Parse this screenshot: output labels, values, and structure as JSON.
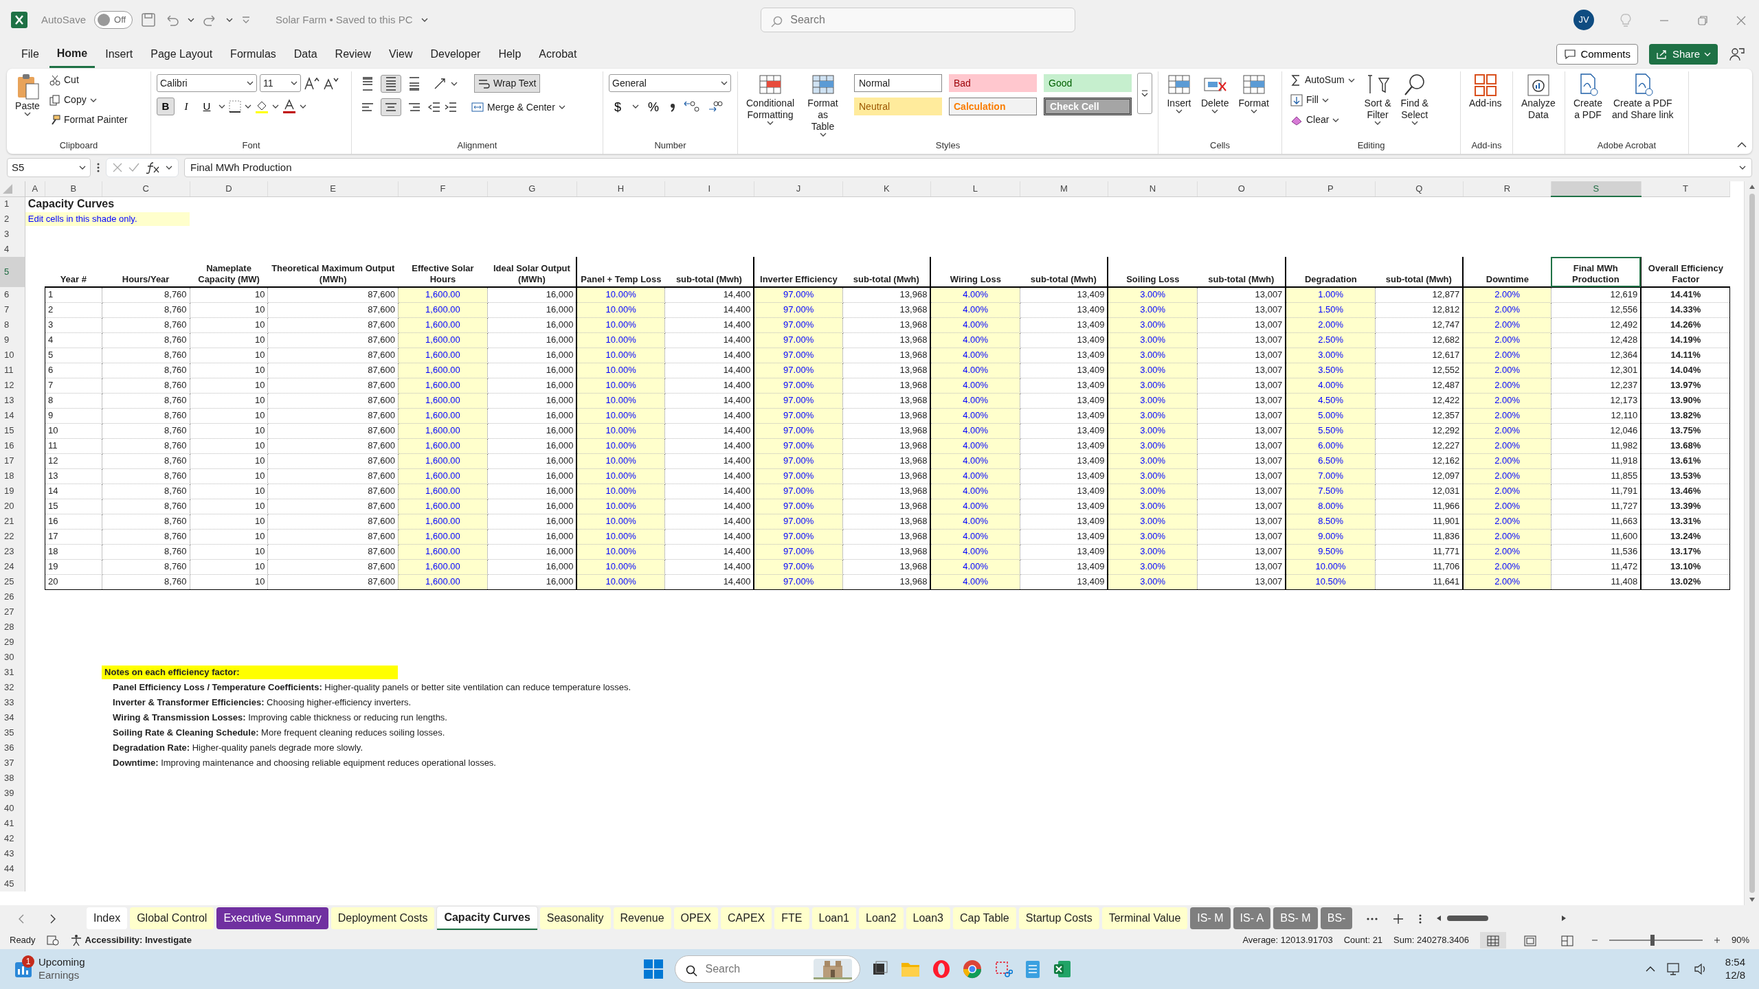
{
  "title_bar": {
    "autosave_label": "AutoSave",
    "autosave": {
      "label": "Off",
      "on": false
    },
    "document_title": "Solar Farm • Saved to this PC",
    "search_placeholder": "Search",
    "avatar": "JV"
  },
  "menu_tabs": [
    {
      "label": "File",
      "selected": false
    },
    {
      "label": "Home",
      "selected": true
    },
    {
      "label": "Insert",
      "selected": false
    },
    {
      "label": "Page Layout",
      "selected": false
    },
    {
      "label": "Formulas",
      "selected": false
    },
    {
      "label": "Data",
      "selected": false
    },
    {
      "label": "Review",
      "selected": false
    },
    {
      "label": "View",
      "selected": false
    },
    {
      "label": "Developer",
      "selected": false
    },
    {
      "label": "Help",
      "selected": false
    },
    {
      "label": "Acrobat",
      "selected": false
    }
  ],
  "header_buttons": [
    "Comments",
    "Share"
  ],
  "ribbon": {
    "groups": [
      {
        "label": "Clipboard",
        "paste": "Paste",
        "buttons": [
          "Cut",
          "Copy",
          "Format Painter"
        ]
      },
      {
        "label": "Font",
        "font": "Calibri",
        "size": "11",
        "format_buttons": [
          {
            "label": "B",
            "selected": true
          },
          {
            "label": "I",
            "selected": false
          },
          {
            "label": "U",
            "selected": false
          }
        ]
      },
      {
        "label": "Alignment",
        "vertical_align": [
          {
            "selected": false
          },
          {
            "selected": true
          },
          {
            "selected": false
          }
        ],
        "horizontal_align": [
          {
            "selected": false
          },
          {
            "selected": true
          },
          {
            "selected": false
          }
        ],
        "wrap_text": {
          "label": "Wrap Text",
          "selected": true
        },
        "merge": "Merge & Center"
      },
      {
        "label": "Number",
        "format": "General",
        "buttons": [
          "$",
          "%"
        ]
      },
      {
        "label": "Styles",
        "buttons": [
          "Conditional\nFormatting",
          "Format as\nTable"
        ],
        "cell_styles": [
          {
            "label": "Normal",
            "kind": "normal"
          },
          {
            "label": "Bad",
            "kind": "bad"
          },
          {
            "label": "Good",
            "kind": "good"
          },
          {
            "label": "Neutral",
            "kind": "neutral"
          },
          {
            "label": "Calculation",
            "kind": "calculation"
          },
          {
            "label": "Check Cell",
            "kind": "check"
          }
        ]
      },
      {
        "label": "Cells",
        "buttons": [
          "Insert",
          "Delete",
          "Format"
        ]
      },
      {
        "label": "Editing",
        "small_buttons": [
          "AutoSum",
          "Fill",
          "Clear"
        ],
        "buttons": [
          "Sort &\nFilter",
          "Find &\nSelect"
        ]
      },
      {
        "label": "Add-ins",
        "buttons": [
          "Add-ins"
        ]
      },
      {
        "buttons": [
          "Analyze\nData"
        ]
      },
      {
        "label": "Adobe Acrobat",
        "buttons": [
          "Create\na PDF",
          "Create a PDF\nand Share link"
        ]
      }
    ]
  },
  "formula_bar": {
    "name_box": "S5",
    "formula": "Final MWh Production"
  },
  "column_letters": [
    {
      "label": "A",
      "selected": false
    },
    {
      "label": "B",
      "selected": false
    },
    {
      "label": "C",
      "selected": false
    },
    {
      "label": "D",
      "selected": false
    },
    {
      "label": "E",
      "selected": false
    },
    {
      "label": "F",
      "selected": false
    },
    {
      "label": "G",
      "selected": false
    },
    {
      "label": "H",
      "selected": false
    },
    {
      "label": "I",
      "selected": false
    },
    {
      "label": "J",
      "selected": false
    },
    {
      "label": "K",
      "selected": false
    },
    {
      "label": "L",
      "selected": false
    },
    {
      "label": "M",
      "selected": false
    },
    {
      "label": "N",
      "selected": false
    },
    {
      "label": "O",
      "selected": false
    },
    {
      "label": "P",
      "selected": false
    },
    {
      "label": "Q",
      "selected": false
    },
    {
      "label": "R",
      "selected": false
    },
    {
      "label": "S",
      "selected": true
    },
    {
      "label": "T",
      "selected": false
    }
  ],
  "row_numbers": [
    {
      "label": "1",
      "selected": false
    },
    {
      "label": "2",
      "selected": false
    },
    {
      "label": "3",
      "selected": false
    },
    {
      "label": "4",
      "selected": false
    },
    {
      "label": "5",
      "selected": true
    },
    {
      "label": "6",
      "selected": false
    },
    {
      "label": "7",
      "selected": false
    },
    {
      "label": "8",
      "selected": false
    },
    {
      "label": "9",
      "selected": false
    },
    {
      "label": "10",
      "selected": false
    },
    {
      "label": "11",
      "selected": false
    },
    {
      "label": "12",
      "selected": false
    },
    {
      "label": "13",
      "selected": false
    },
    {
      "label": "14",
      "selected": false
    },
    {
      "label": "15",
      "selected": false
    },
    {
      "label": "16",
      "selected": false
    },
    {
      "label": "17",
      "selected": false
    },
    {
      "label": "18",
      "selected": false
    },
    {
      "label": "19",
      "selected": false
    },
    {
      "label": "20",
      "selected": false
    },
    {
      "label": "21",
      "selected": false
    },
    {
      "label": "22",
      "selected": false
    },
    {
      "label": "23",
      "selected": false
    },
    {
      "label": "24",
      "selected": false
    },
    {
      "label": "25",
      "selected": false
    },
    {
      "label": "26",
      "selected": false
    },
    {
      "label": "27",
      "selected": false
    },
    {
      "label": "28",
      "selected": false
    },
    {
      "label": "29",
      "selected": false
    },
    {
      "label": "30",
      "selected": false
    },
    {
      "label": "31",
      "selected": false
    },
    {
      "label": "32",
      "selected": false
    },
    {
      "label": "33",
      "selected": false
    },
    {
      "label": "34",
      "selected": false
    },
    {
      "label": "35",
      "selected": false
    },
    {
      "label": "36",
      "selected": false
    },
    {
      "label": "37",
      "selected": false
    },
    {
      "label": "38",
      "selected": false
    },
    {
      "label": "39",
      "selected": false
    },
    {
      "label": "40",
      "selected": false
    },
    {
      "label": "41",
      "selected": false
    },
    {
      "label": "42",
      "selected": false
    },
    {
      "label": "43",
      "selected": false
    },
    {
      "label": "44",
      "selected": false
    },
    {
      "label": "45",
      "selected": false
    }
  ],
  "sheet": {
    "title": "Capacity Curves",
    "hint": "Edit cells in this shade only.",
    "table": {
      "columns": [
        {
          "header": "Year #",
          "kind": "year"
        },
        {
          "header": "Hours/Year",
          "kind": "calc"
        },
        {
          "header": "Nameplate Capacity (MW)",
          "kind": "calc"
        },
        {
          "header": "Theoretical Maximum Output (MWh)",
          "kind": "calc"
        },
        {
          "header": "Effective Solar Hours",
          "kind": "input"
        },
        {
          "header": "Ideal Solar Output (MWh)",
          "kind": "calc"
        },
        {
          "header": "Panel + Temp Loss",
          "kind": "input"
        },
        {
          "header": "sub-total (Mwh)",
          "kind": "calc"
        },
        {
          "header": "Inverter Efficiency",
          "kind": "input"
        },
        {
          "header": "sub-total (Mwh)",
          "kind": "calc"
        },
        {
          "header": "Wiring Loss",
          "kind": "input"
        },
        {
          "header": "sub-total (Mwh)",
          "kind": "calc"
        },
        {
          "header": "Soiling Loss",
          "kind": "input"
        },
        {
          "header": "sub-total (Mwh)",
          "kind": "calc"
        },
        {
          "header": "Degradation",
          "kind": "input"
        },
        {
          "header": "sub-total (Mwh)",
          "kind": "calc"
        },
        {
          "header": "Downtime",
          "kind": "input"
        },
        {
          "header": "Final MWh Production",
          "kind": "calc"
        },
        {
          "header": "Overall Efficiency Factor",
          "kind": "result"
        }
      ],
      "rows": [
        [
          "1",
          "8,760",
          "10",
          "87,600",
          "1,600.00",
          "16,000",
          "10.00%",
          "14,400",
          "97.00%",
          "13,968",
          "4.00%",
          "13,409",
          "3.00%",
          "13,007",
          "1.00%",
          "12,877",
          "2.00%",
          "12,619",
          "14.41%"
        ],
        [
          "2",
          "8,760",
          "10",
          "87,600",
          "1,600.00",
          "16,000",
          "10.00%",
          "14,400",
          "97.00%",
          "13,968",
          "4.00%",
          "13,409",
          "3.00%",
          "13,007",
          "1.50%",
          "12,812",
          "2.00%",
          "12,556",
          "14.33%"
        ],
        [
          "3",
          "8,760",
          "10",
          "87,600",
          "1,600.00",
          "16,000",
          "10.00%",
          "14,400",
          "97.00%",
          "13,968",
          "4.00%",
          "13,409",
          "3.00%",
          "13,007",
          "2.00%",
          "12,747",
          "2.00%",
          "12,492",
          "14.26%"
        ],
        [
          "4",
          "8,760",
          "10",
          "87,600",
          "1,600.00",
          "16,000",
          "10.00%",
          "14,400",
          "97.00%",
          "13,968",
          "4.00%",
          "13,409",
          "3.00%",
          "13,007",
          "2.50%",
          "12,682",
          "2.00%",
          "12,428",
          "14.19%"
        ],
        [
          "5",
          "8,760",
          "10",
          "87,600",
          "1,600.00",
          "16,000",
          "10.00%",
          "14,400",
          "97.00%",
          "13,968",
          "4.00%",
          "13,409",
          "3.00%",
          "13,007",
          "3.00%",
          "12,617",
          "2.00%",
          "12,364",
          "14.11%"
        ],
        [
          "6",
          "8,760",
          "10",
          "87,600",
          "1,600.00",
          "16,000",
          "10.00%",
          "14,400",
          "97.00%",
          "13,968",
          "4.00%",
          "13,409",
          "3.00%",
          "13,007",
          "3.50%",
          "12,552",
          "2.00%",
          "12,301",
          "14.04%"
        ],
        [
          "7",
          "8,760",
          "10",
          "87,600",
          "1,600.00",
          "16,000",
          "10.00%",
          "14,400",
          "97.00%",
          "13,968",
          "4.00%",
          "13,409",
          "3.00%",
          "13,007",
          "4.00%",
          "12,487",
          "2.00%",
          "12,237",
          "13.97%"
        ],
        [
          "8",
          "8,760",
          "10",
          "87,600",
          "1,600.00",
          "16,000",
          "10.00%",
          "14,400",
          "97.00%",
          "13,968",
          "4.00%",
          "13,409",
          "3.00%",
          "13,007",
          "4.50%",
          "12,422",
          "2.00%",
          "12,173",
          "13.90%"
        ],
        [
          "9",
          "8,760",
          "10",
          "87,600",
          "1,600.00",
          "16,000",
          "10.00%",
          "14,400",
          "97.00%",
          "13,968",
          "4.00%",
          "13,409",
          "3.00%",
          "13,007",
          "5.00%",
          "12,357",
          "2.00%",
          "12,110",
          "13.82%"
        ],
        [
          "10",
          "8,760",
          "10",
          "87,600",
          "1,600.00",
          "16,000",
          "10.00%",
          "14,400",
          "97.00%",
          "13,968",
          "4.00%",
          "13,409",
          "3.00%",
          "13,007",
          "5.50%",
          "12,292",
          "2.00%",
          "12,046",
          "13.75%"
        ],
        [
          "11",
          "8,760",
          "10",
          "87,600",
          "1,600.00",
          "16,000",
          "10.00%",
          "14,400",
          "97.00%",
          "13,968",
          "4.00%",
          "13,409",
          "3.00%",
          "13,007",
          "6.00%",
          "12,227",
          "2.00%",
          "11,982",
          "13.68%"
        ],
        [
          "12",
          "8,760",
          "10",
          "87,600",
          "1,600.00",
          "16,000",
          "10.00%",
          "14,400",
          "97.00%",
          "13,968",
          "4.00%",
          "13,409",
          "3.00%",
          "13,007",
          "6.50%",
          "12,162",
          "2.00%",
          "11,918",
          "13.61%"
        ],
        [
          "13",
          "8,760",
          "10",
          "87,600",
          "1,600.00",
          "16,000",
          "10.00%",
          "14,400",
          "97.00%",
          "13,968",
          "4.00%",
          "13,409",
          "3.00%",
          "13,007",
          "7.00%",
          "12,097",
          "2.00%",
          "11,855",
          "13.53%"
        ],
        [
          "14",
          "8,760",
          "10",
          "87,600",
          "1,600.00",
          "16,000",
          "10.00%",
          "14,400",
          "97.00%",
          "13,968",
          "4.00%",
          "13,409",
          "3.00%",
          "13,007",
          "7.50%",
          "12,031",
          "2.00%",
          "11,791",
          "13.46%"
        ],
        [
          "15",
          "8,760",
          "10",
          "87,600",
          "1,600.00",
          "16,000",
          "10.00%",
          "14,400",
          "97.00%",
          "13,968",
          "4.00%",
          "13,409",
          "3.00%",
          "13,007",
          "8.00%",
          "11,966",
          "2.00%",
          "11,727",
          "13.39%"
        ],
        [
          "16",
          "8,760",
          "10",
          "87,600",
          "1,600.00",
          "16,000",
          "10.00%",
          "14,400",
          "97.00%",
          "13,968",
          "4.00%",
          "13,409",
          "3.00%",
          "13,007",
          "8.50%",
          "11,901",
          "2.00%",
          "11,663",
          "13.31%"
        ],
        [
          "17",
          "8,760",
          "10",
          "87,600",
          "1,600.00",
          "16,000",
          "10.00%",
          "14,400",
          "97.00%",
          "13,968",
          "4.00%",
          "13,409",
          "3.00%",
          "13,007",
          "9.00%",
          "11,836",
          "2.00%",
          "11,600",
          "13.24%"
        ],
        [
          "18",
          "8,760",
          "10",
          "87,600",
          "1,600.00",
          "16,000",
          "10.00%",
          "14,400",
          "97.00%",
          "13,968",
          "4.00%",
          "13,409",
          "3.00%",
          "13,007",
          "9.50%",
          "11,771",
          "2.00%",
          "11,536",
          "13.17%"
        ],
        [
          "19",
          "8,760",
          "10",
          "87,600",
          "1,600.00",
          "16,000",
          "10.00%",
          "14,400",
          "97.00%",
          "13,968",
          "4.00%",
          "13,409",
          "3.00%",
          "13,007",
          "10.00%",
          "11,706",
          "2.00%",
          "11,472",
          "13.10%"
        ],
        [
          "20",
          "8,760",
          "10",
          "87,600",
          "1,600.00",
          "16,000",
          "10.00%",
          "14,400",
          "97.00%",
          "13,968",
          "4.00%",
          "13,409",
          "3.00%",
          "13,007",
          "10.50%",
          "11,641",
          "2.00%",
          "11,408",
          "13.02%"
        ]
      ]
    },
    "notes": {
      "heading": "Notes on each efficiency factor:",
      "lines": [
        "**Panel Efficiency Loss / Temperature Coefficients:** Higher-quality panels or better site ventilation can reduce temperature losses.",
        "**Inverter & Transformer Efficiencies:** Choosing higher-efficiency inverters.",
        "**Wiring & Transmission Losses:** Improving cable thickness or reducing run lengths.",
        "**Soiling Rate & Cleaning Schedule:** More frequent cleaning reduces soiling losses.",
        "**Degradation Rate:** Higher-quality panels degrade more slowly.",
        "**Downtime:** Improving maintenance and choosing reliable equipment reduces operational losses."
      ]
    }
  },
  "sheet_tabs": [
    {
      "label": "Index",
      "selected": false,
      "color": "#ffffff"
    },
    {
      "label": "Global Control",
      "selected": false,
      "color": "#ffffcc"
    },
    {
      "label": "Executive Summary",
      "selected": false,
      "color": "#7030a0"
    },
    {
      "label": "Deployment Costs",
      "selected": false,
      "color": "#ffffcc"
    },
    {
      "label": "Capacity Curves",
      "selected": true,
      "color": "#ffffff"
    },
    {
      "label": "Seasonality",
      "selected": false,
      "color": "#ffffcc"
    },
    {
      "label": "Revenue",
      "selected": false,
      "color": "#ffffcc"
    },
    {
      "label": "OPEX",
      "selected": false,
      "color": "#ffffcc"
    },
    {
      "label": "CAPEX",
      "selected": false,
      "color": "#ffffcc"
    },
    {
      "label": "FTE",
      "selected": false,
      "color": "#ffffcc"
    },
    {
      "label": "Loan1",
      "selected": false,
      "color": "#ffffcc"
    },
    {
      "label": "Loan2",
      "selected": false,
      "color": "#ffffcc"
    },
    {
      "label": "Loan3",
      "selected": false,
      "color": "#ffffcc"
    },
    {
      "label": "Cap Table",
      "selected": false,
      "color": "#ffffcc"
    },
    {
      "label": "Startup Costs",
      "selected": false,
      "color": "#ffffcc"
    },
    {
      "label": "Terminal Value",
      "selected": false,
      "color": "#ffffcc"
    },
    {
      "label": "IS- M",
      "selected": false,
      "color": "#7f7f7f"
    },
    {
      "label": "IS- A",
      "selected": false,
      "color": "#7f7f7f"
    },
    {
      "label": "BS- M",
      "selected": false,
      "color": "#7f7f7f"
    },
    {
      "label": "BS-",
      "selected": false,
      "color": "#7f7f7f"
    }
  ],
  "status_bar": {
    "mode": "Ready",
    "accessibility": "Accessibility: Investigate",
    "average": "Average: 12013.91703",
    "count": "Count: 21",
    "sum": "Sum: 240278.3406",
    "views": [
      {
        "selected": true
      },
      {
        "selected": false
      },
      {
        "selected": false
      }
    ],
    "zoom_slider": {
      "level": 0.46
    },
    "zoom": "90%"
  },
  "taskbar": {
    "widget_badge": "1",
    "widget_title": "Upcoming",
    "widget_subtitle": "Earnings",
    "search_placeholder": "Search",
    "time": "8:54",
    "date": "12/8"
  }
}
